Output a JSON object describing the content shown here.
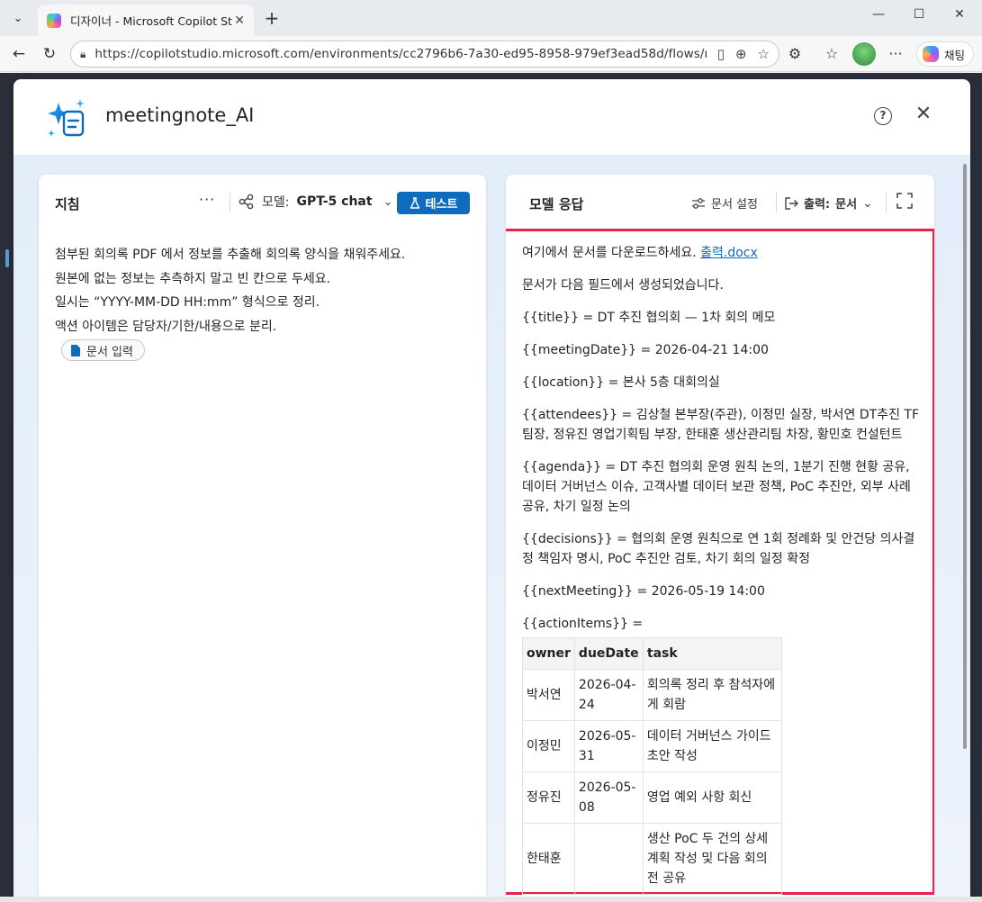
{
  "browser": {
    "tab_title": "디자이너 - Microsoft Copilot Studio",
    "url": "https://copilotstudio.microsoft.com/environments/cc2796b6-7a30-ed95-8958-979ef3ead58d/flows/new",
    "copilot_label": "채팅",
    "icons": [
      "tab-menu-icon",
      "back-icon",
      "refresh-icon",
      "site-info-icon",
      "reading-view-icon",
      "zoom-icon",
      "favorite-icon",
      "extensions-icon",
      "favorites-icon",
      "more-icon"
    ]
  },
  "dialog": {
    "title": "meetingnote_AI"
  },
  "left_panel": {
    "title": "지침",
    "more": "···",
    "model_label": "모델:",
    "model_value": "GPT-5 chat",
    "test_label": "테스트",
    "instructions": [
      "첨부된 회의록 PDF 에서 정보를 추출해 회의록 양식을 채워주세요.",
      "원본에 없는 정보는 추측하지 말고 빈 칸으로 두세요.",
      "일시는 “YYYY-MM-DD HH:mm” 형식으로 정리.",
      "액션 아이템은 담당자/기한/내용으로 분리."
    ],
    "doc_chip": "문서 입력"
  },
  "right_panel": {
    "title": "모델 응답",
    "doc_settings": "문서 설정",
    "output_label": "출력:",
    "output_value": "문서",
    "download_text": "여기에서 문서를 다운로드하세요.",
    "download_link": "출력.docx",
    "generated_text": "문서가 다음 필드에서 생성되었습니다.",
    "fields": [
      "{{title}} = DT 추진 협의회 — 1차 회의 메모",
      "{{meetingDate}} = 2026-04-21 14:00",
      "{{location}} = 본사 5층 대회의실",
      "{{attendees}} = 김상철 본부장(주관), 이정민 실장, 박서연 DT추진 TF팀장, 정유진 영업기획팀 부장, 한태훈 생산관리팀 차장, 황민호 컨설턴트",
      "{{agenda}} = DT 추진 협의회 운영 원칙 논의, 1분기 진행 현황 공유, 데이터 거버넌스 이슈, 고객사별 데이터 보관 정책, PoC 추진안, 외부 사례 공유, 차기 일정 논의",
      "{{decisions}} = 협의회 운영 원칙으로 연 1회 정례화 및 안건당 의사결정 책임자 명시, PoC 추진안 검토, 차기 회의 일정 확정",
      "{{nextMeeting}} = 2026-05-19 14:00",
      "{{actionItems}} ="
    ],
    "table": {
      "headers": [
        "owner",
        "dueDate",
        "task"
      ],
      "rows": [
        [
          "박서연",
          "2026-04-24",
          "회의록 정리 후 참석자에게 회람"
        ],
        [
          "이정민",
          "2026-05-31",
          "데이터 거버넌스 가이드 초안 작성"
        ],
        [
          "정유진",
          "2026-05-08",
          "영업 예외 사항 회신"
        ],
        [
          "한태훈",
          "",
          "생산 PoC 두 건의 상세 계획 작성 및 다음 회의 전 공유"
        ]
      ]
    }
  },
  "colors": {
    "accent": "#0f6cbd",
    "highlight_border": "#e8214a"
  }
}
